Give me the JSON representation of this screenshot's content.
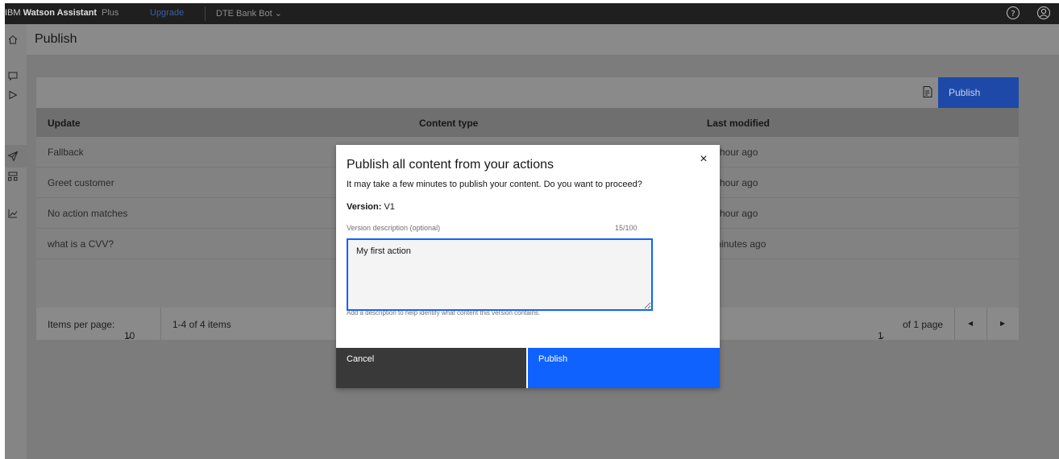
{
  "topbar": {
    "brand_prefix": "IBM",
    "brand_name": "Watson Assistant",
    "plan": "Plus",
    "upgrade": "Upgrade",
    "bot_name": "DTE Bank Bot",
    "help_icon": "help-icon",
    "user_icon": "user-icon"
  },
  "sidebar": {
    "icons": [
      "home-icon",
      "chat-icon",
      "play-icon",
      "publish-icon",
      "environments-icon",
      "analytics-icon"
    ]
  },
  "page": {
    "title": "Publish"
  },
  "toolbar": {
    "publish_label": "Publish"
  },
  "table": {
    "headers": [
      "Update",
      "Content type",
      "Last modified"
    ],
    "rows": [
      {
        "update": "Fallback",
        "content_type": "",
        "last_modified": "hour ago"
      },
      {
        "update": "Greet customer",
        "content_type": "",
        "last_modified": "hour ago"
      },
      {
        "update": "No action matches",
        "content_type": "",
        "last_modified": "hour ago"
      },
      {
        "update": "what is a CVV?",
        "content_type": "",
        "last_modified": "minutes ago"
      }
    ]
  },
  "pagination": {
    "items_per_page_label": "Items per page:",
    "items_per_page": "10",
    "range": "1-4 of 4 items",
    "page": "1",
    "of_pages": "of 1 page"
  },
  "modal": {
    "title": "Publish all content from your actions",
    "body": "It may take a few minutes to publish your content. Do you want to proceed?",
    "version_label": "Version:",
    "version_value": "V1",
    "desc_label": "Version description (optional)",
    "desc_count": "15/100",
    "desc_value": "My first action",
    "helper": "Add a description to help identify what content this version contains.",
    "cancel": "Cancel",
    "publish": "Publish",
    "close": "×"
  }
}
